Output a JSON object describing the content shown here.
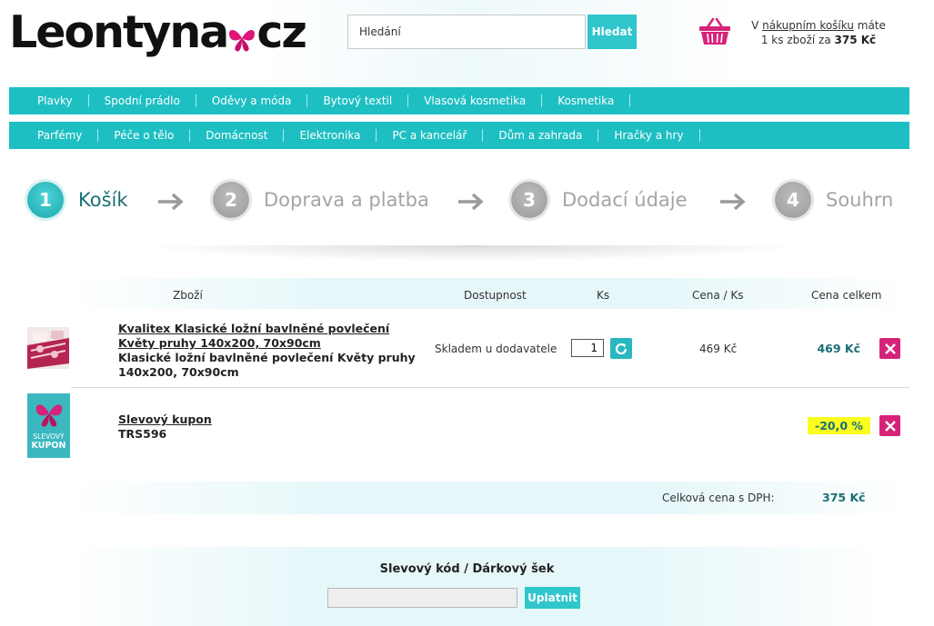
{
  "header": {
    "logo_text": "Leontyna",
    "logo_tld": "cz",
    "search": {
      "value": "Hledání",
      "button": "Hledat"
    },
    "cart": {
      "line1_prefix": "V ",
      "line1_link": "nákupním košíku",
      "line1_suffix": " máte",
      "line2_prefix": "1 ks zboží za ",
      "line2_amount": "375 Kč"
    }
  },
  "nav": {
    "row1": [
      "Plavky",
      "Spodní prádlo",
      "Oděvy a móda",
      "Bytový textil",
      "Vlasová kosmetika",
      "Kosmetika"
    ],
    "row2": [
      "Parfémy",
      "Péče o tělo",
      "Domácnost",
      "Elektronika",
      "PC a kancelář",
      "Dům a zahrada",
      "Hračky a hry"
    ]
  },
  "steps": [
    {
      "number": "1",
      "label": "Košík"
    },
    {
      "number": "2",
      "label": "Doprava a platba"
    },
    {
      "number": "3",
      "label": "Dodací údaje"
    },
    {
      "number": "4",
      "label": "Souhrn"
    }
  ],
  "table": {
    "headers": {
      "product": "Zboží",
      "availability": "Dostupnost",
      "qty": "Ks",
      "unit_price": "Cena / Ks",
      "total": "Cena celkem"
    },
    "items": [
      {
        "name_line1": "Kvalitex Klasické ložní bavlněné povlečení",
        "name_line2": "Květy pruhy 140x200, 70x90cm",
        "desc_line1": "Klasické ložní bavlněné povlečení Květy pruhy",
        "desc_line2": "140x200, 70x90cm",
        "availability": "Skladem u dodavatele",
        "qty": "1",
        "unit_price": "469 Kč",
        "total": "469 Kč"
      }
    ],
    "coupon": {
      "name": "Slevový kupon",
      "code": "TRS596",
      "discount": "-20,0 %",
      "thumb_line1": "SLEVOVÝ",
      "thumb_line2": "KUPON"
    },
    "total_label": "Celková cena s DPH:",
    "total_value": "375 Kč"
  },
  "discount_code": {
    "title": "Slevový kód / Dárkový šek",
    "value": "",
    "button": "Uplatnit"
  },
  "colors": {
    "accent": "#1ebfc3",
    "brand_pink": "#d6237a",
    "price": "#1a6e78",
    "highlight": "#fafd1e"
  }
}
